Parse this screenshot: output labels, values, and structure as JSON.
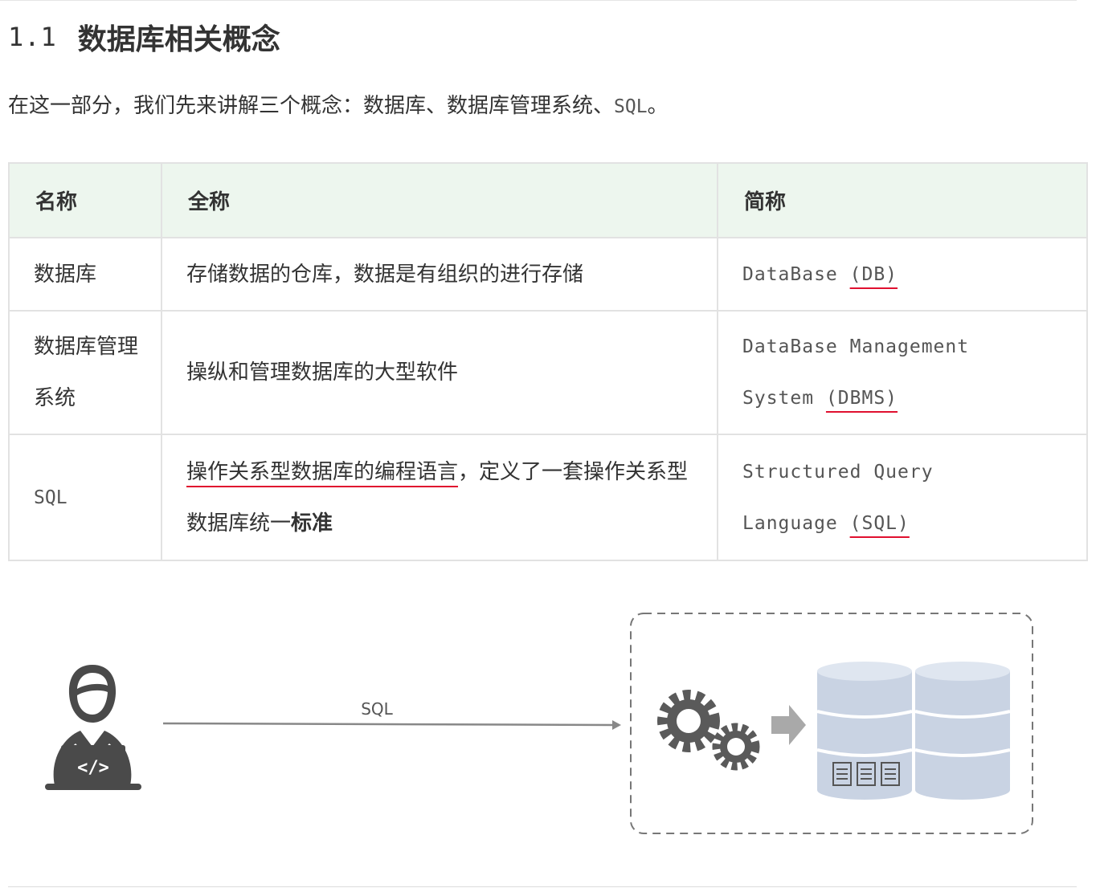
{
  "heading": {
    "number": "1.1",
    "title": "数据库相关概念"
  },
  "intro": {
    "text": "在这一部分，我们先来讲解三个概念：数据库、数据库管理系统、",
    "code": "SQL",
    "end": "。"
  },
  "table": {
    "headers": [
      "名称",
      "全称",
      "简称"
    ],
    "rows": [
      {
        "name": "数据库",
        "full": "存储数据的仓库，数据是有组织的进行存储",
        "abbr_prefix": "DataBase ",
        "abbr_marked": "(DB)",
        "abbr_suffix": ""
      },
      {
        "name": "数据库管理系统",
        "full": "操纵和管理数据库的大型软件",
        "abbr_prefix": "DataBase Management System ",
        "abbr_marked": "(DBMS)",
        "abbr_suffix": ""
      },
      {
        "name": "SQL",
        "full_marked": "操作关系型数据库的编程语言",
        "full_rest": "，定义了一套操作关系型数据库统一",
        "full_strong": "标准",
        "abbr_prefix": "Structured Query Language ",
        "abbr_marked": "(SQL)",
        "abbr_suffix": ""
      }
    ]
  },
  "diagram": {
    "arrow_label": "SQL",
    "code_symbol": "</>"
  },
  "colors": {
    "header_bg": "#edf6ee",
    "underline": "#e0102f",
    "icon_gray": "#4a4a4a",
    "db_blue": "#c9d3e3"
  }
}
